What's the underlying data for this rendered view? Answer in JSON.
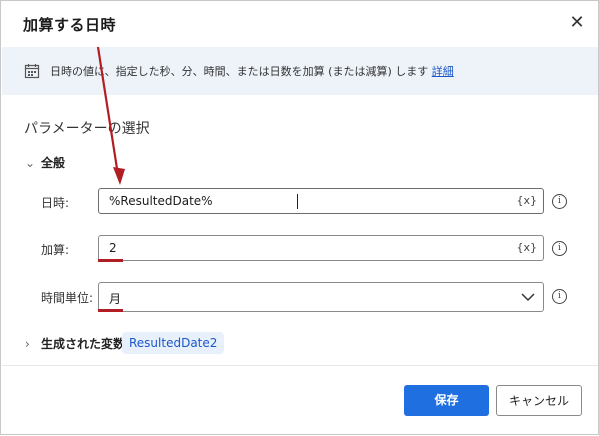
{
  "dialog": {
    "title": "加算する日時",
    "close_icon": "close-icon"
  },
  "info": {
    "icon": "calendar-icon",
    "text": "日時の値に、指定した秒、分、時間、または日数を加算 (または減算) します",
    "link": "詳細"
  },
  "section_title": "パラメーターの選択",
  "group": {
    "label": "全般",
    "icon": "chevron-down-icon"
  },
  "fields": {
    "datetime": {
      "label": "日時:",
      "value": "%ResultedDate%",
      "var_button": "{x}"
    },
    "add": {
      "label": "加算:",
      "value": "2",
      "var_button": "{x}"
    },
    "unit": {
      "label": "時間単位:",
      "value": "月",
      "icon": "chevron-down-icon"
    }
  },
  "info_icon": "i",
  "generated": {
    "label": "生成された変数",
    "icon": "chevron-right-icon",
    "variable": "ResultedDate2"
  },
  "buttons": {
    "save": "保存",
    "cancel": "キャンセル"
  },
  "colors": {
    "primary": "#1f6fe0",
    "annotation": "#b01e23",
    "link": "#1b57c8",
    "info_bg": "#eef3fa"
  }
}
